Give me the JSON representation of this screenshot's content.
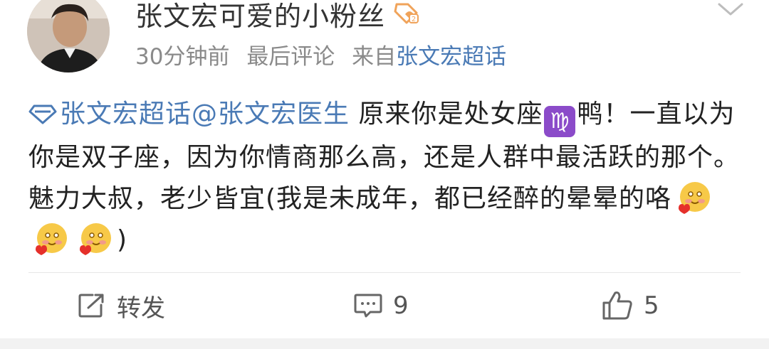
{
  "post": {
    "author": "张文宏可爱的小粉丝",
    "time": "30分钟前",
    "last_comment": "最后评论",
    "source_prefix": "来自",
    "source": "张文宏超话",
    "topic_link": "张文宏超话",
    "mention": "@张文宏医生",
    "text_1": " 原来你是处女座",
    "zodiac_symbol": "♍",
    "text_2": "鸭！一直以为你是双子座，因为你情商那么高，还是人群中最活跃的那个。魅力大叔，老少皆宜(我是未成年，都已经醉的晕晕的咯",
    "text_3": ")"
  },
  "actions": {
    "repost": "转发",
    "comments": "9",
    "likes": "5"
  },
  "icons": {
    "badge": "fan-badge-icon",
    "chevron": "chevron-down-icon",
    "topic": "diamond-topic-icon",
    "repost": "share-icon",
    "comment": "comment-icon",
    "like": "thumbs-up-icon",
    "emoji": "blush-heart-emoji"
  },
  "colors": {
    "link": "#4a7ab5",
    "virgo": "#8b4bc9",
    "badge": "#f0a35a"
  }
}
